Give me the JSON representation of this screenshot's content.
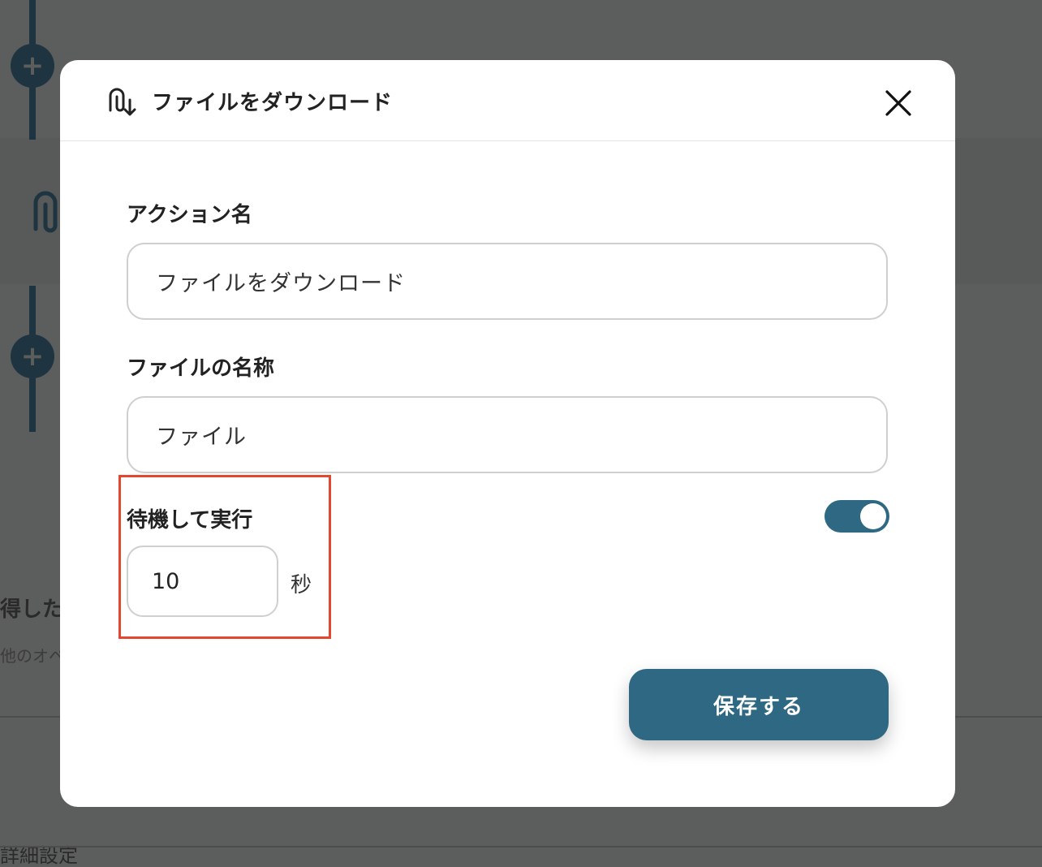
{
  "background": {
    "partial_heading": "得した",
    "partial_subtext": "他のオペ",
    "partial_bottom_text": "詳細設定"
  },
  "modal": {
    "title": "ファイルをダウンロード",
    "title_icon": "paperclip-download-icon",
    "close_icon": "close-icon",
    "fields": {
      "action_name": {
        "label": "アクション名",
        "value": "ファイルをダウンロード"
      },
      "file_name": {
        "label": "ファイルの名称",
        "value": "ファイル"
      },
      "wait": {
        "label": "待機して実行",
        "value": "10",
        "unit": "秒",
        "enabled": true
      }
    },
    "save_label": "保存する"
  },
  "colors": {
    "accent": "#2e6882",
    "highlight": "#e4472f",
    "rail": "#1e3440"
  }
}
